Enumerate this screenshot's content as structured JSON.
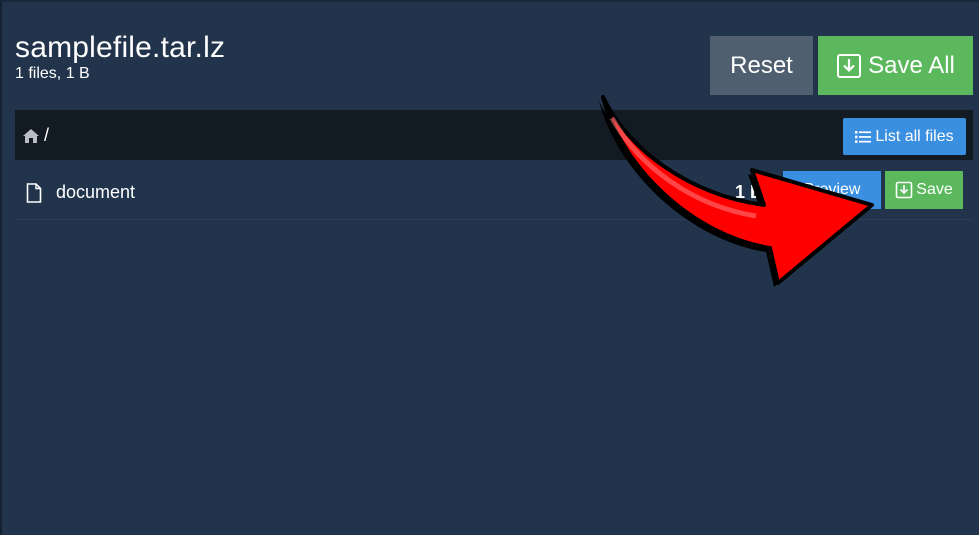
{
  "archive": {
    "title": "samplefile.tar.lz",
    "subtitle": "1 files, 1 B"
  },
  "toolbar": {
    "reset_label": "Reset",
    "save_all_label": "Save All"
  },
  "path": {
    "separator": "/",
    "list_all_label": "List all files"
  },
  "files": [
    {
      "name": "document",
      "size": "1 B",
      "preview_label": "Preview",
      "save_label": "Save"
    }
  ],
  "colors": {
    "background": "#21344b",
    "path_bar": "#121a24",
    "reset": "#4f5f70",
    "save_green": "#5cb85c",
    "action_blue": "#3b8fe0",
    "annotation_arrow": "#ff0000"
  },
  "icons": {
    "download": "download-icon",
    "home": "home-icon",
    "list": "list-icon",
    "file": "file-icon"
  }
}
